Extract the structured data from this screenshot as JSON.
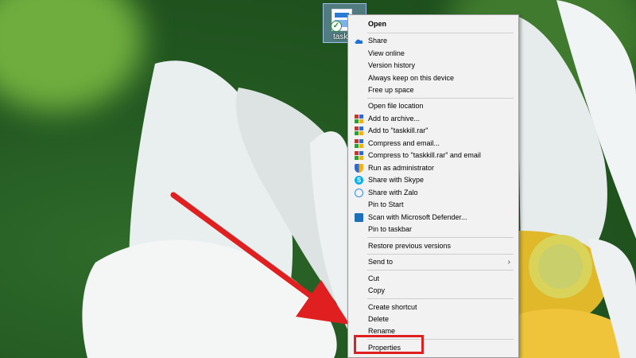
{
  "desktop": {
    "icon_label": "taskk"
  },
  "context_menu": {
    "items": [
      {
        "label": "Open",
        "bold": true,
        "icon": ""
      },
      {
        "label": "Share",
        "icon": "onedrive-cloud-icon"
      },
      {
        "label": "View online",
        "icon": ""
      },
      {
        "label": "Version history",
        "icon": ""
      },
      {
        "label": "Always keep on this device",
        "icon": ""
      },
      {
        "label": "Free up space",
        "icon": ""
      },
      {
        "label": "Open file location",
        "icon": ""
      },
      {
        "label": "Add to archive...",
        "icon": "winrar-icon"
      },
      {
        "label": "Add to \"taskkill.rar\"",
        "icon": "winrar-icon"
      },
      {
        "label": "Compress and email...",
        "icon": "winrar-icon"
      },
      {
        "label": "Compress to \"taskkill.rar\" and email",
        "icon": "winrar-icon"
      },
      {
        "label": "Run as administrator",
        "icon": "uac-shield-icon"
      },
      {
        "label": "Share with Skype",
        "icon": "skype-icon"
      },
      {
        "label": "Share with Zalo",
        "icon": "zalo-icon"
      },
      {
        "label": "Pin to Start",
        "icon": ""
      },
      {
        "label": "Scan with Microsoft Defender...",
        "icon": "defender-icon"
      },
      {
        "label": "Pin to taskbar",
        "icon": ""
      },
      {
        "label": "Restore previous versions",
        "icon": ""
      },
      {
        "label": "Send to",
        "icon": "",
        "submenu": true
      },
      {
        "label": "Cut",
        "icon": ""
      },
      {
        "label": "Copy",
        "icon": ""
      },
      {
        "label": "Create shortcut",
        "icon": ""
      },
      {
        "label": "Delete",
        "icon": ""
      },
      {
        "label": "Rename",
        "icon": ""
      },
      {
        "label": "Properties",
        "icon": ""
      }
    ]
  },
  "colors": {
    "highlight": "#e02020",
    "annotation_arrow": "#e02020",
    "menu_bg": "#f2f2f2"
  }
}
